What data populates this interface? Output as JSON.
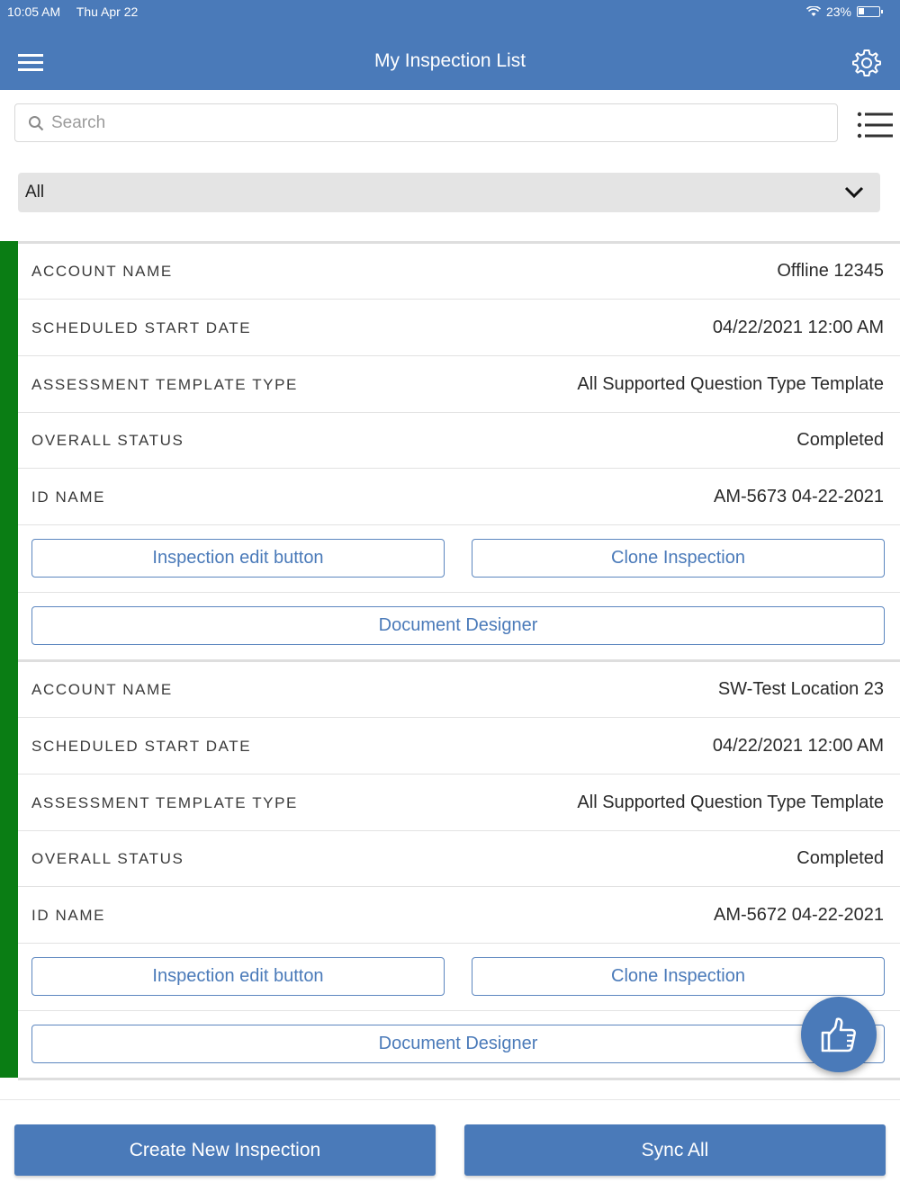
{
  "status_bar": {
    "time": "10:05 AM",
    "date": "Thu Apr 22",
    "battery": "23%"
  },
  "header": {
    "title": "My Inspection List"
  },
  "search": {
    "placeholder": "Search"
  },
  "filter": {
    "selected": "All"
  },
  "labels": {
    "account_name": "ACCOUNT NAME",
    "scheduled_start_date": "SCHEDULED START DATE",
    "assessment_template_type": "ASSESSMENT TEMPLATE TYPE",
    "overall_status": "OVERALL STATUS",
    "id_name": "ID NAME"
  },
  "inspections": [
    {
      "account_name": "Offline 12345",
      "scheduled_start_date": "04/22/2021 12:00 AM",
      "assessment_template_type": "All Supported Question Type Template",
      "overall_status": "Completed",
      "id_name": "AM-5673 04-22-2021"
    },
    {
      "account_name": "SW-Test Location 23",
      "scheduled_start_date": "04/22/2021 12:00 AM",
      "assessment_template_type": "All Supported Question Type Template",
      "overall_status": "Completed",
      "id_name": "AM-5672 04-22-2021"
    }
  ],
  "actions": {
    "edit": "Inspection edit button",
    "clone": "Clone Inspection",
    "designer": "Document Designer"
  },
  "footer": {
    "create": "Create New Inspection",
    "sync": "Sync All"
  },
  "colors": {
    "brand": "#4a7ab9",
    "accent": "#0a7d14"
  },
  "icons": [
    "menu-icon",
    "gear-icon",
    "search-icon",
    "list-icon",
    "chevron-down-icon",
    "thumbs-up-icon",
    "wifi-icon",
    "battery-icon"
  ]
}
